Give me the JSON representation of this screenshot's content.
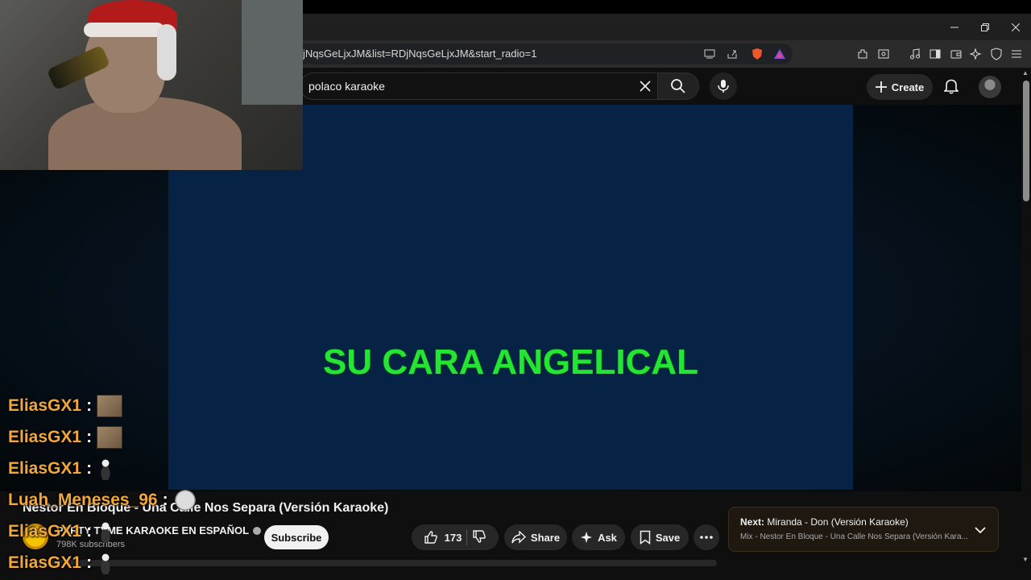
{
  "browser": {
    "url": "jNqsGeLjxJM&list=RDjNqsGeLjxJM&start_radio=1"
  },
  "header": {
    "search_value": "polaco karaoke",
    "create_label": "Create"
  },
  "video": {
    "lyric": "SU CARA ANGELICAL",
    "title": "Nestor En Bloque - Una Calle Nos Separa (Versión Karaoke)",
    "channel": "PARTY TYME KARAOKE EN ESPAÑOL",
    "subscribers": "798K subscribers",
    "subscribe_label": "Subscribe",
    "likes": "173",
    "share_label": "Share",
    "ask_label": "Ask",
    "save_label": "Save"
  },
  "next": {
    "prefix": "Next:",
    "title": "Miranda - Don (Versión Karaoke)",
    "subtitle": "Mix - Nestor En Bloque - Una Calle Nos Separa (Versión Kara..."
  },
  "chat": [
    {
      "user": "EliasGX1",
      "emote": "photo"
    },
    {
      "user": "EliasGX1",
      "emote": "photo"
    },
    {
      "user": "EliasGX1",
      "emote": "dancer"
    },
    {
      "user": "Luah_Meneses_96",
      "emote": "troll"
    },
    {
      "user": "EliasGX1",
      "emote": "dancer"
    },
    {
      "user": "EliasGX1",
      "emote": "dancer"
    }
  ],
  "colors": {
    "lyric": "#25e533",
    "player_bg": "#062244",
    "chat_user": "#f2a73a"
  }
}
